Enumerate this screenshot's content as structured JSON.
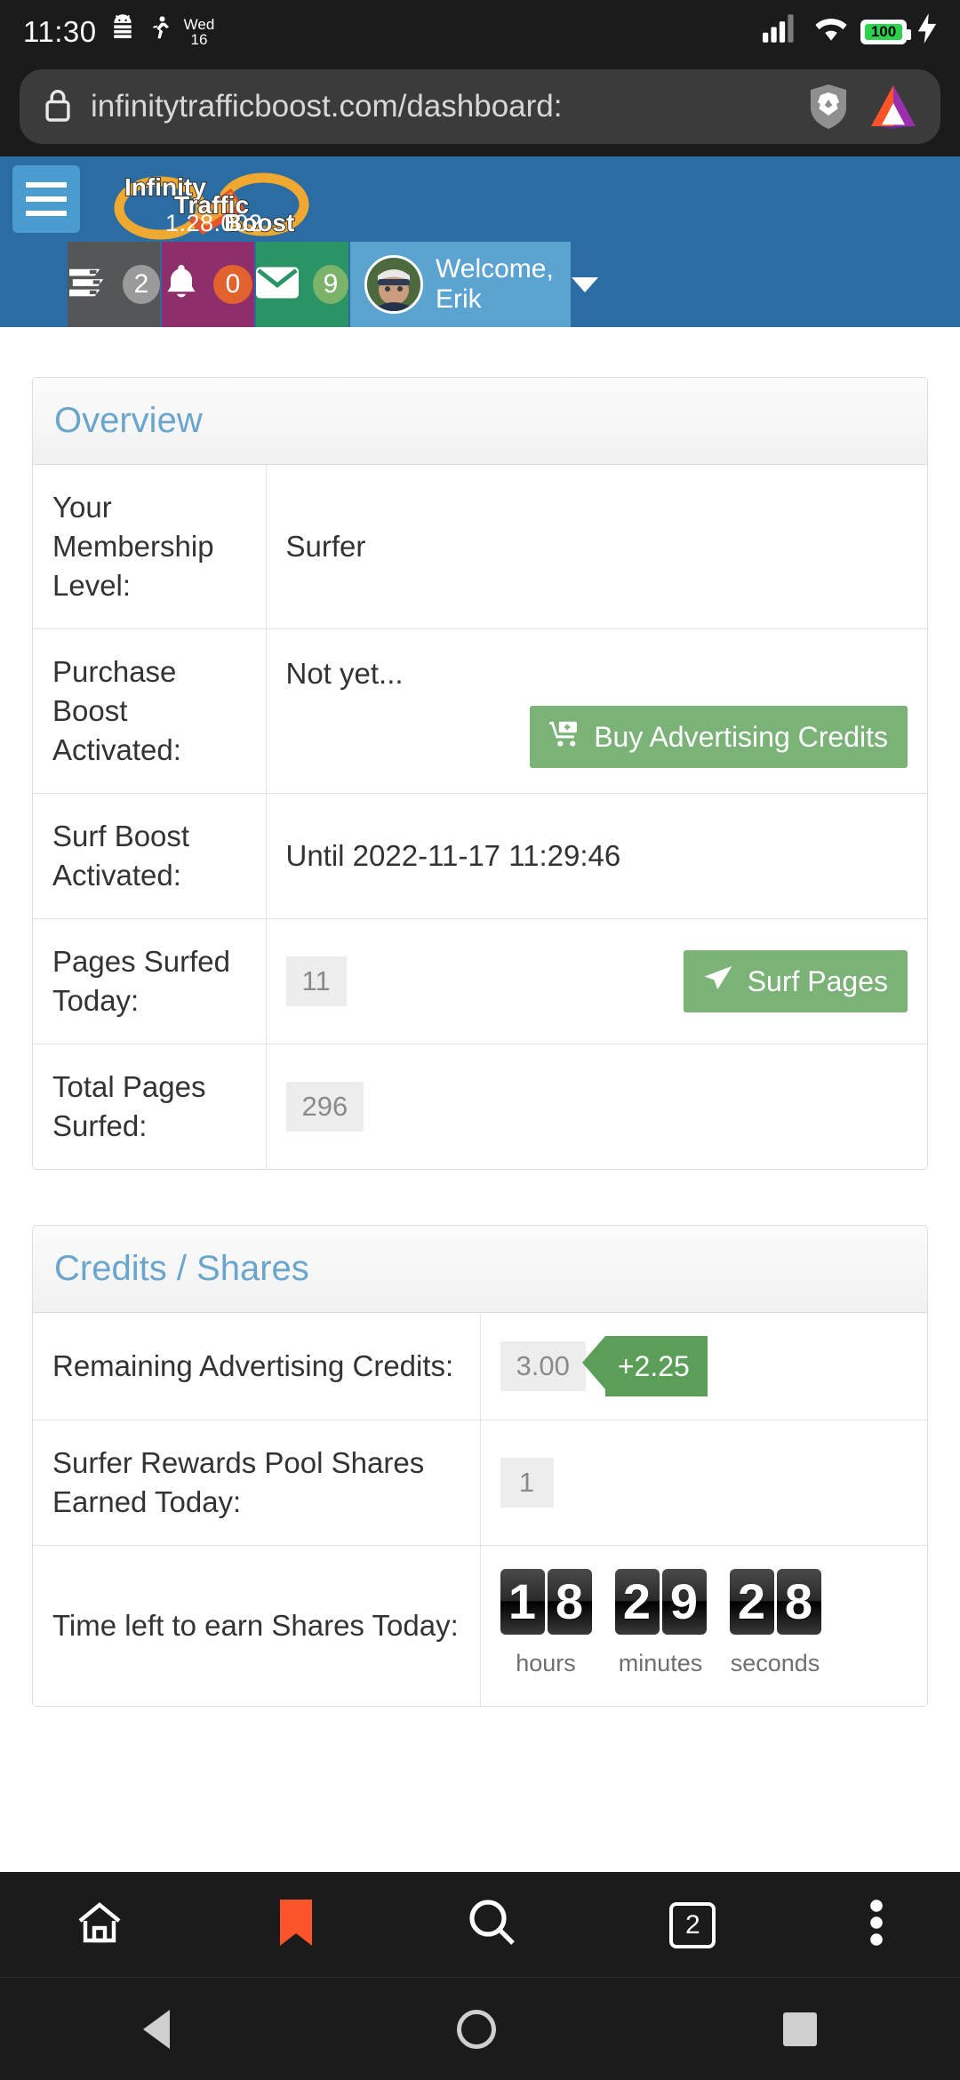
{
  "status_bar": {
    "time": "11:30",
    "date_day": "Wed",
    "date_num": "16",
    "battery_level": "100",
    "icons": [
      "android-icon",
      "running-icon",
      "signal-icon",
      "wifi-icon",
      "battery-icon",
      "charging-bolt-icon"
    ]
  },
  "browser": {
    "url": "infinitytrafficboost.com/dashboard:",
    "lock_icon": "lock-icon",
    "shield_icon": "brave-shield-icon",
    "rewards_icon": "bat-triangle-icon",
    "bottom_bar": {
      "home": "home-icon",
      "bookmarks": "bookmark-icon",
      "search": "search-icon",
      "tab_count": "2",
      "menu": "overflow-menu-icon"
    }
  },
  "site_header": {
    "menu_icon": "hamburger-menu-icon",
    "logo_line1": "Infinity",
    "logo_line2": "Traffic",
    "logo_line3": "Boost",
    "version": "1.28.002"
  },
  "nav_tiles": [
    {
      "name": "tasks",
      "icon": "tasks-icon",
      "badge": "2"
    },
    {
      "name": "notifications",
      "icon": "bell-icon",
      "badge": "0"
    },
    {
      "name": "messages",
      "icon": "envelope-icon",
      "badge": "9"
    }
  ],
  "user_menu": {
    "greeting_line1": "Welcome,",
    "greeting_line2": "Erik",
    "avatar": "user-avatar",
    "caret": "chevron-down-icon"
  },
  "overview": {
    "title": "Overview",
    "rows": [
      {
        "label": "Your Membership Level:",
        "value": "Surfer"
      },
      {
        "label": "Purchase Boost Activated:",
        "value": "Not yet...",
        "button": "Buy Advertising Credits",
        "button_icon": "cart-plus-icon"
      },
      {
        "label": "Surf Boost Activated:",
        "value": "Until 2022-11-17 11:29:46"
      },
      {
        "label": "Pages Surfed Today:",
        "chip": "11",
        "button": "Surf Pages",
        "button_icon": "paper-plane-icon"
      },
      {
        "label": "Total Pages Surfed:",
        "chip": "296"
      }
    ]
  },
  "credits": {
    "title": "Credits / Shares",
    "rows": [
      {
        "label": "Remaining Advertising Credits:",
        "chip": "3.00",
        "ribbon": "+2.25"
      },
      {
        "label": "Surfer Rewards Pool Shares Earned Today:",
        "chip": "1"
      },
      {
        "label": "Time left to earn Shares Today:",
        "clock": true
      }
    ],
    "countdown": {
      "hours": "18",
      "minutes": "29",
      "seconds": "28",
      "hours_label": "hours",
      "minutes_label": "minutes",
      "seconds_label": "seconds"
    }
  },
  "colors": {
    "header_blue": "#2b6ca3",
    "tile_gray": "#54565a",
    "tile_magenta": "#8e2f6b",
    "tile_green": "#2a9464",
    "tile_lightblue": "#5ba4d2",
    "button_green": "#7bb277",
    "ribbon_green": "#5a9e57",
    "panel_title_blue": "#6aa5cc",
    "badge_orange": "#e2622f"
  }
}
